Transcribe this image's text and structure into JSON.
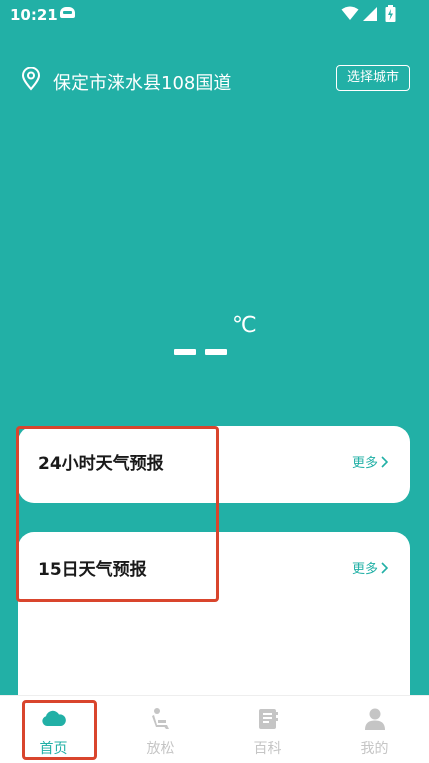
{
  "status_bar": {
    "time": "10:21"
  },
  "location": {
    "address": "保定市涞水县108国道",
    "select_city_label": "选择城市"
  },
  "weather": {
    "temperature_unit": "℃"
  },
  "cards": [
    {
      "title": "24小时天气预报",
      "more_label": "更多"
    },
    {
      "title": "15日天气预报",
      "more_label": "更多"
    }
  ],
  "bottom_nav": {
    "items": [
      {
        "label": "首页",
        "icon": "cloud-icon",
        "active": true
      },
      {
        "label": "放松",
        "icon": "seat-icon",
        "active": false
      },
      {
        "label": "百科",
        "icon": "book-icon",
        "active": false
      },
      {
        "label": "我的",
        "icon": "person-icon",
        "active": false
      }
    ]
  },
  "colors": {
    "accent": "#22b0a6",
    "annotation": "#d9452d",
    "inactive": "#c5c5c5"
  }
}
